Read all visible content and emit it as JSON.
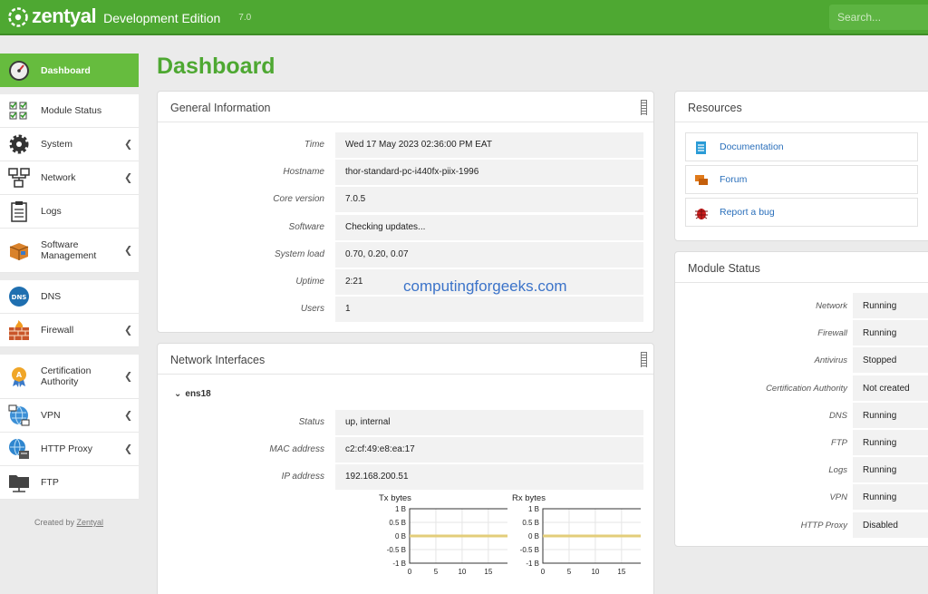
{
  "header": {
    "brand": "zentyal",
    "edition": "Development Edition",
    "version": "7.0",
    "search_placeholder": "Search..."
  },
  "page_title": "Dashboard",
  "sidebar": {
    "items": [
      {
        "label": "Dashboard",
        "icon": "dashboard-gauge-icon",
        "active": true
      },
      {
        "label": "Module Status",
        "icon": "module-status-checklist-icon"
      },
      {
        "label": "System",
        "icon": "gear-icon",
        "chevron": true
      },
      {
        "label": "Network",
        "icon": "network-icon",
        "chevron": true
      },
      {
        "label": "Logs",
        "icon": "clipboard-icon"
      },
      {
        "label": "Software Management",
        "icon": "package-box-icon",
        "chevron": true
      },
      {
        "label": "DNS",
        "icon": "dns-icon"
      },
      {
        "label": "Firewall",
        "icon": "firewall-brick-icon",
        "chevron": true
      },
      {
        "label": "Certification Authority",
        "icon": "certificate-icon",
        "chevron": true
      },
      {
        "label": "VPN",
        "icon": "vpn-icon",
        "chevron": true
      },
      {
        "label": "HTTP Proxy",
        "icon": "proxy-globe-icon",
        "chevron": true
      },
      {
        "label": "FTP",
        "icon": "ftp-folder-icon"
      }
    ],
    "created_by_prefix": "Created by",
    "created_by_link": "Zentyal"
  },
  "general_info": {
    "title": "General Information",
    "rows": [
      {
        "key": "Time",
        "value": "Wed 17 May 2023 02:36:00 PM EAT"
      },
      {
        "key": "Hostname",
        "value": "thor-standard-pc-i440fx-piix-1996"
      },
      {
        "key": "Core version",
        "value": "7.0.5"
      },
      {
        "key": "Software",
        "value": "Checking updates..."
      },
      {
        "key": "System load",
        "value": "0.70, 0.20, 0.07"
      },
      {
        "key": "Uptime",
        "value": "2:21"
      },
      {
        "key": "Users",
        "value": "1"
      }
    ]
  },
  "watermark": "computingforgeeks.com",
  "network_interfaces": {
    "title": "Network Interfaces",
    "iface": "ens18",
    "rows": [
      {
        "key": "Status",
        "value": "up, internal"
      },
      {
        "key": "MAC address",
        "value": "c2:cf:49:e8:ea:17"
      },
      {
        "key": "IP address",
        "value": "192.168.200.51"
      }
    ]
  },
  "resources": {
    "title": "Resources",
    "links": [
      {
        "label": "Documentation",
        "icon": "document-icon",
        "color": "#2a9bd6"
      },
      {
        "label": "Forum",
        "icon": "forum-chat-icon",
        "color": "#e07a1a"
      },
      {
        "label": "Report a bug",
        "icon": "bug-icon",
        "color": "#cc1f1f"
      }
    ]
  },
  "module_status": {
    "title": "Module Status",
    "rows": [
      {
        "key": "Network",
        "value": "Running"
      },
      {
        "key": "Firewall",
        "value": "Running"
      },
      {
        "key": "Antivirus",
        "value": "Stopped"
      },
      {
        "key": "Certification Authority",
        "value": "Not created"
      },
      {
        "key": "DNS",
        "value": "Running"
      },
      {
        "key": "FTP",
        "value": "Running"
      },
      {
        "key": "Logs",
        "value": "Running"
      },
      {
        "key": "VPN",
        "value": "Running"
      },
      {
        "key": "HTTP Proxy",
        "value": "Disabled"
      }
    ]
  },
  "chart_data": [
    {
      "type": "line",
      "title": "Tx bytes",
      "x": [
        0,
        1,
        2,
        3,
        4,
        5,
        6,
        7,
        8,
        9,
        10,
        11,
        12,
        13,
        14,
        15,
        16,
        17,
        18,
        19
      ],
      "series": [
        {
          "values": [
            0,
            0,
            0,
            0,
            0,
            0,
            0,
            0,
            0,
            0,
            0,
            0,
            0,
            0,
            0,
            0,
            0,
            0,
            0,
            0
          ]
        }
      ],
      "xticks": [
        "0",
        "5",
        "10",
        "15"
      ],
      "yticks": [
        "1 B",
        "0.5 B",
        "0 B",
        "-0.5 B",
        "-1 B"
      ],
      "xlim": [
        0,
        19
      ],
      "ylim": [
        -1,
        1
      ],
      "grid": true,
      "line_color": "#e3cd7a"
    },
    {
      "type": "line",
      "title": "Rx bytes",
      "x": [
        0,
        1,
        2,
        3,
        4,
        5,
        6,
        7,
        8,
        9,
        10,
        11,
        12,
        13,
        14,
        15,
        16,
        17,
        18,
        19
      ],
      "series": [
        {
          "values": [
            0,
            0,
            0,
            0,
            0,
            0,
            0,
            0,
            0,
            0,
            0,
            0,
            0,
            0,
            0,
            0,
            0,
            0,
            0,
            0
          ]
        }
      ],
      "xticks": [
        "0",
        "5",
        "10",
        "15"
      ],
      "yticks": [
        "1 B",
        "0.5 B",
        "0 B",
        "-0.5 B",
        "-1 B"
      ],
      "xlim": [
        0,
        19
      ],
      "ylim": [
        -1,
        1
      ],
      "grid": true,
      "line_color": "#e3cd7a"
    }
  ]
}
